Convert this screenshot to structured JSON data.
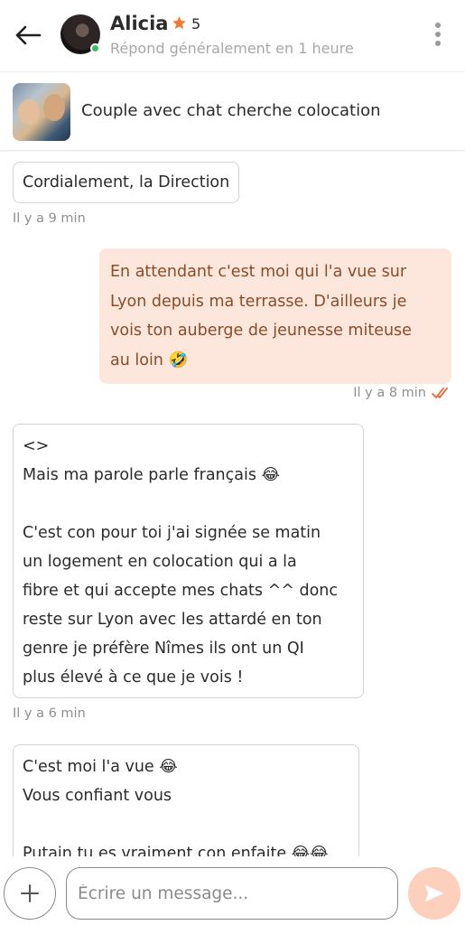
{
  "header": {
    "name": "Alicia",
    "rating": "5",
    "status": "Répond généralement en 1 heure",
    "icons": {
      "back": "arrow-left-icon",
      "star": "star-icon",
      "menu": "kebab-menu-icon"
    },
    "accent_color": "#f07a32",
    "online_color": "#3cb96a"
  },
  "listing": {
    "title": "Couple avec chat cherche colocation"
  },
  "messages": [
    {
      "direction": "in",
      "text": "Cordialement, la Direction",
      "time": "Il y a 9 min"
    },
    {
      "direction": "out",
      "text": "En attendant c'est moi qui l'a vue sur\nLyon depuis ma terrasse. D'ailleurs je\nvois ton auberge de jeunesse miteuse\nau loin 🤣",
      "time": "Il y a 8 min",
      "read": true
    },
    {
      "direction": "in",
      "text": "<>\nMais ma parole parle français 😂\n\nC'est con pour toi j'ai signée se matin\nun logement en colocation qui a la\nfibre et qui accepte mes chats ^^ donc\nreste sur Lyon avec les attardé en ton\ngenre je préfère Nîmes ils ont un QI\nplus élevé à ce que je vois !",
      "time": "Il y a 6 min"
    },
    {
      "direction": "in",
      "text": "C'est moi l'a vue 😂\nVous confiant vous\n\nPutain tu es vraiment con enfaite 😂😂",
      "time": ""
    }
  ],
  "composer": {
    "placeholder": "Écrire un message...",
    "icons": {
      "add": "plus-icon",
      "send": "send-icon"
    },
    "send_color": "#fcd0bd"
  }
}
